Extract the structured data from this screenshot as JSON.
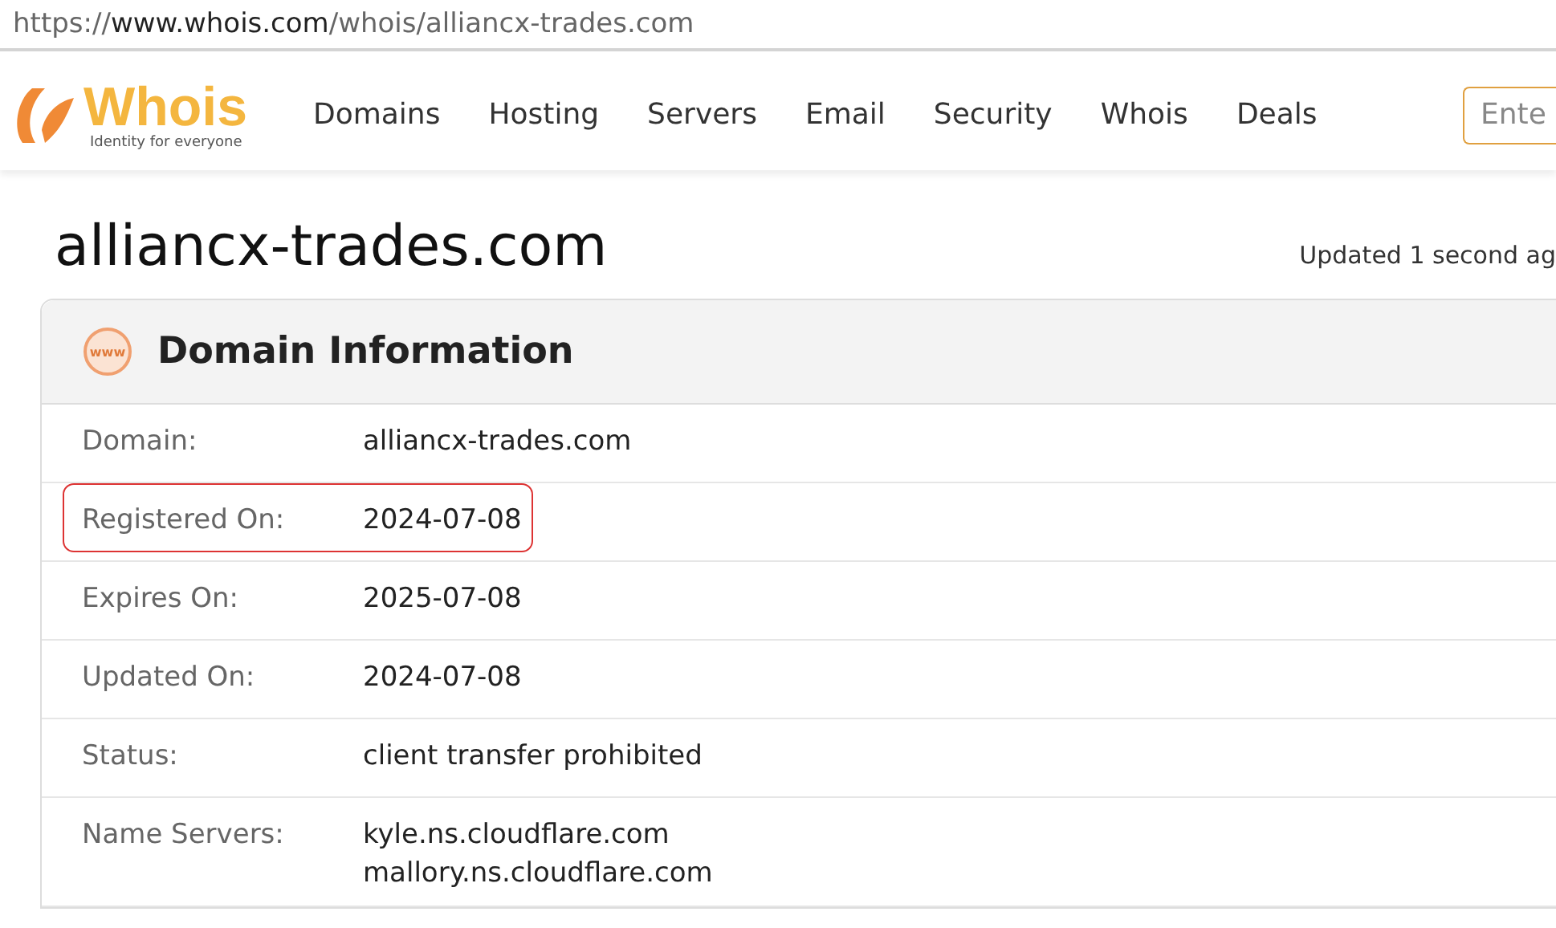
{
  "address_bar": {
    "scheme": "https://",
    "host": "www.whois.com",
    "path": "/whois/alliancx-trades.com"
  },
  "header": {
    "logo": {
      "name": "Whois",
      "tagline": "Identity for everyone"
    },
    "nav": [
      "Domains",
      "Hosting",
      "Servers",
      "Email",
      "Security",
      "Whois",
      "Deals"
    ],
    "search": {
      "placeholder": "Ente"
    }
  },
  "page": {
    "title": "alliancx-trades.com",
    "updated": "Updated 1 second ag"
  },
  "card": {
    "icon_text": "www",
    "title": "Domain Information",
    "rows": [
      {
        "label": "Domain:",
        "values": [
          "alliancx-trades.com"
        ],
        "highlighted": false
      },
      {
        "label": "Registered On:",
        "values": [
          "2024-07-08"
        ],
        "highlighted": true
      },
      {
        "label": "Expires On:",
        "values": [
          "2025-07-08"
        ],
        "highlighted": false
      },
      {
        "label": "Updated On:",
        "values": [
          "2024-07-08"
        ],
        "highlighted": false
      },
      {
        "label": "Status:",
        "values": [
          "client transfer prohibited"
        ],
        "highlighted": false
      },
      {
        "label": "Name Servers:",
        "values": [
          "kyle.ns.cloudflare.com",
          "mallory.ns.cloudflare.com"
        ],
        "highlighted": false
      }
    ]
  }
}
